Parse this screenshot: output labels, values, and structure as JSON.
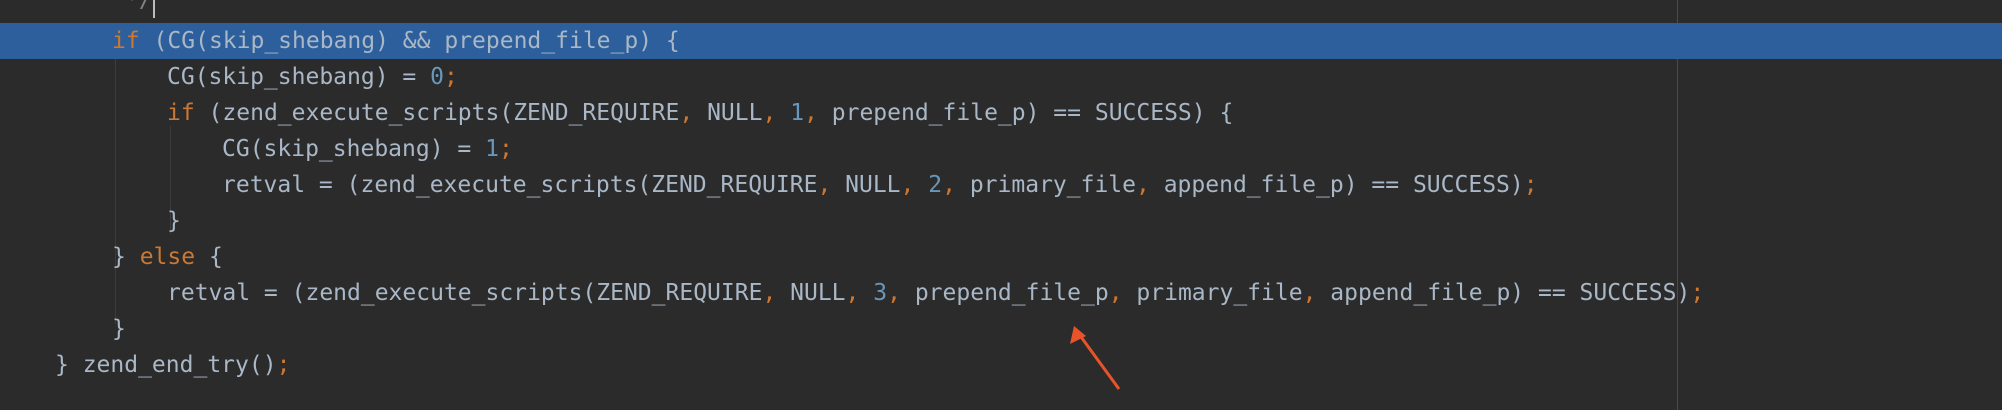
{
  "editor": {
    "lines": [
      {
        "tokens": [
          {
            "text": "*/",
            "cls": "comment"
          }
        ]
      },
      {
        "tokens": [
          {
            "text": "if",
            "cls": "kw"
          },
          {
            "text": " (CG(skip_shebang) && prepend_file_p) {",
            "cls": ""
          }
        ]
      },
      {
        "tokens": [
          {
            "text": "CG(skip_shebang) = ",
            "cls": ""
          },
          {
            "text": "0",
            "cls": "num"
          },
          {
            "text": ";",
            "cls": "punc"
          }
        ]
      },
      {
        "tokens": [
          {
            "text": "if",
            "cls": "kw"
          },
          {
            "text": " (zend_execute_scripts(ZEND_REQUIRE",
            "cls": ""
          },
          {
            "text": ",",
            "cls": "punc"
          },
          {
            "text": " NULL",
            "cls": ""
          },
          {
            "text": ",",
            "cls": "punc"
          },
          {
            "text": " ",
            "cls": ""
          },
          {
            "text": "1",
            "cls": "num"
          },
          {
            "text": ",",
            "cls": "punc"
          },
          {
            "text": " prepend_file_p) == SUCCESS) {",
            "cls": ""
          }
        ]
      },
      {
        "tokens": [
          {
            "text": "CG(skip_shebang) = ",
            "cls": ""
          },
          {
            "text": "1",
            "cls": "num"
          },
          {
            "text": ";",
            "cls": "punc"
          }
        ]
      },
      {
        "tokens": [
          {
            "text": "retval = (zend_execute_scripts(ZEND_REQUIRE",
            "cls": ""
          },
          {
            "text": ",",
            "cls": "punc"
          },
          {
            "text": " NULL",
            "cls": ""
          },
          {
            "text": ",",
            "cls": "punc"
          },
          {
            "text": " ",
            "cls": ""
          },
          {
            "text": "2",
            "cls": "num"
          },
          {
            "text": ",",
            "cls": "punc"
          },
          {
            "text": " primary_file",
            "cls": ""
          },
          {
            "text": ",",
            "cls": "punc"
          },
          {
            "text": " append_file_p) == SUCCESS)",
            "cls": ""
          },
          {
            "text": ";",
            "cls": "punc"
          }
        ]
      },
      {
        "tokens": [
          {
            "text": "}",
            "cls": ""
          }
        ]
      },
      {
        "tokens": [
          {
            "text": "} ",
            "cls": ""
          },
          {
            "text": "else",
            "cls": "kw"
          },
          {
            "text": " {",
            "cls": ""
          }
        ]
      },
      {
        "tokens": [
          {
            "text": "retval = (zend_execute_scripts(ZEND_REQUIRE",
            "cls": ""
          },
          {
            "text": ",",
            "cls": "punc"
          },
          {
            "text": " NULL",
            "cls": ""
          },
          {
            "text": ",",
            "cls": "punc"
          },
          {
            "text": " ",
            "cls": ""
          },
          {
            "text": "3",
            "cls": "num"
          },
          {
            "text": ",",
            "cls": "punc"
          },
          {
            "text": " prepend_file_p",
            "cls": ""
          },
          {
            "text": ",",
            "cls": "punc"
          },
          {
            "text": " primary_file",
            "cls": ""
          },
          {
            "text": ",",
            "cls": "punc"
          },
          {
            "text": " append_file_p) == SUCCESS)",
            "cls": ""
          },
          {
            "text": ";",
            "cls": "punc"
          }
        ]
      },
      {
        "tokens": [
          {
            "text": "}",
            "cls": ""
          }
        ]
      },
      {
        "tokens": [
          {
            "text": "} zend_end_try()",
            "cls": ""
          },
          {
            "text": ";",
            "cls": "punc"
          }
        ]
      }
    ]
  },
  "colors": {
    "background": "#2b2b2b",
    "selection": "#2d5f9c",
    "text": "#a9b7c6",
    "keyword": "#cc7832",
    "number": "#6897bb",
    "annotation_arrow": "#e8542a"
  }
}
